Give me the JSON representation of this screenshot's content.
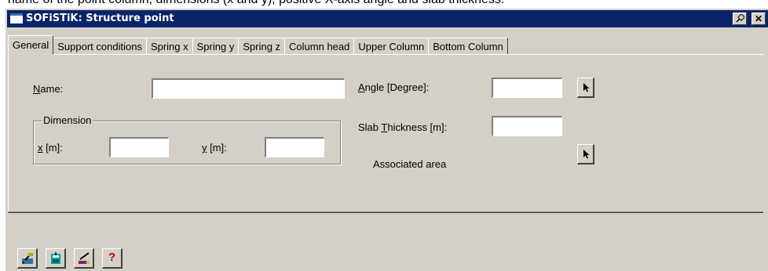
{
  "caption": "name of the point column, dimensions (x and y), positive X-axis angle and slab thickness.",
  "window": {
    "title": "SOFiSTiK: Structure point",
    "close_label": "✕"
  },
  "tabs": [
    {
      "label": "General",
      "active": true
    },
    {
      "label": "Support conditions",
      "active": false
    },
    {
      "label": "Spring x",
      "active": false
    },
    {
      "label": "Spring y",
      "active": false
    },
    {
      "label": "Spring z",
      "active": false
    },
    {
      "label": "Column head",
      "active": false
    },
    {
      "label": "Upper Column",
      "active": false
    },
    {
      "label": "Bottom Column",
      "active": false
    }
  ],
  "general": {
    "name_label_ul": "N",
    "name_label_rest": "ame:",
    "name_value": "",
    "dimension_title": "Dimension",
    "x_label_ul": "x",
    "x_label_rest": " [m]:",
    "x_value": "",
    "y_label_ul": "y",
    "y_label_rest": " [m]:",
    "y_value": "",
    "angle_label_ul": "A",
    "angle_label_rest": "ngle [Degree]:",
    "angle_value": "",
    "slab_label_pre": "Slab ",
    "slab_label_ul": "T",
    "slab_label_rest": "hickness [m]:",
    "slab_value": "",
    "associated_area_label": "Associated area"
  },
  "toolbar": {
    "buttons": [
      {
        "icon": "apply-icon"
      },
      {
        "icon": "database-icon"
      },
      {
        "icon": "graphics-icon"
      },
      {
        "icon": "help-icon",
        "glyph": "?"
      }
    ]
  }
}
